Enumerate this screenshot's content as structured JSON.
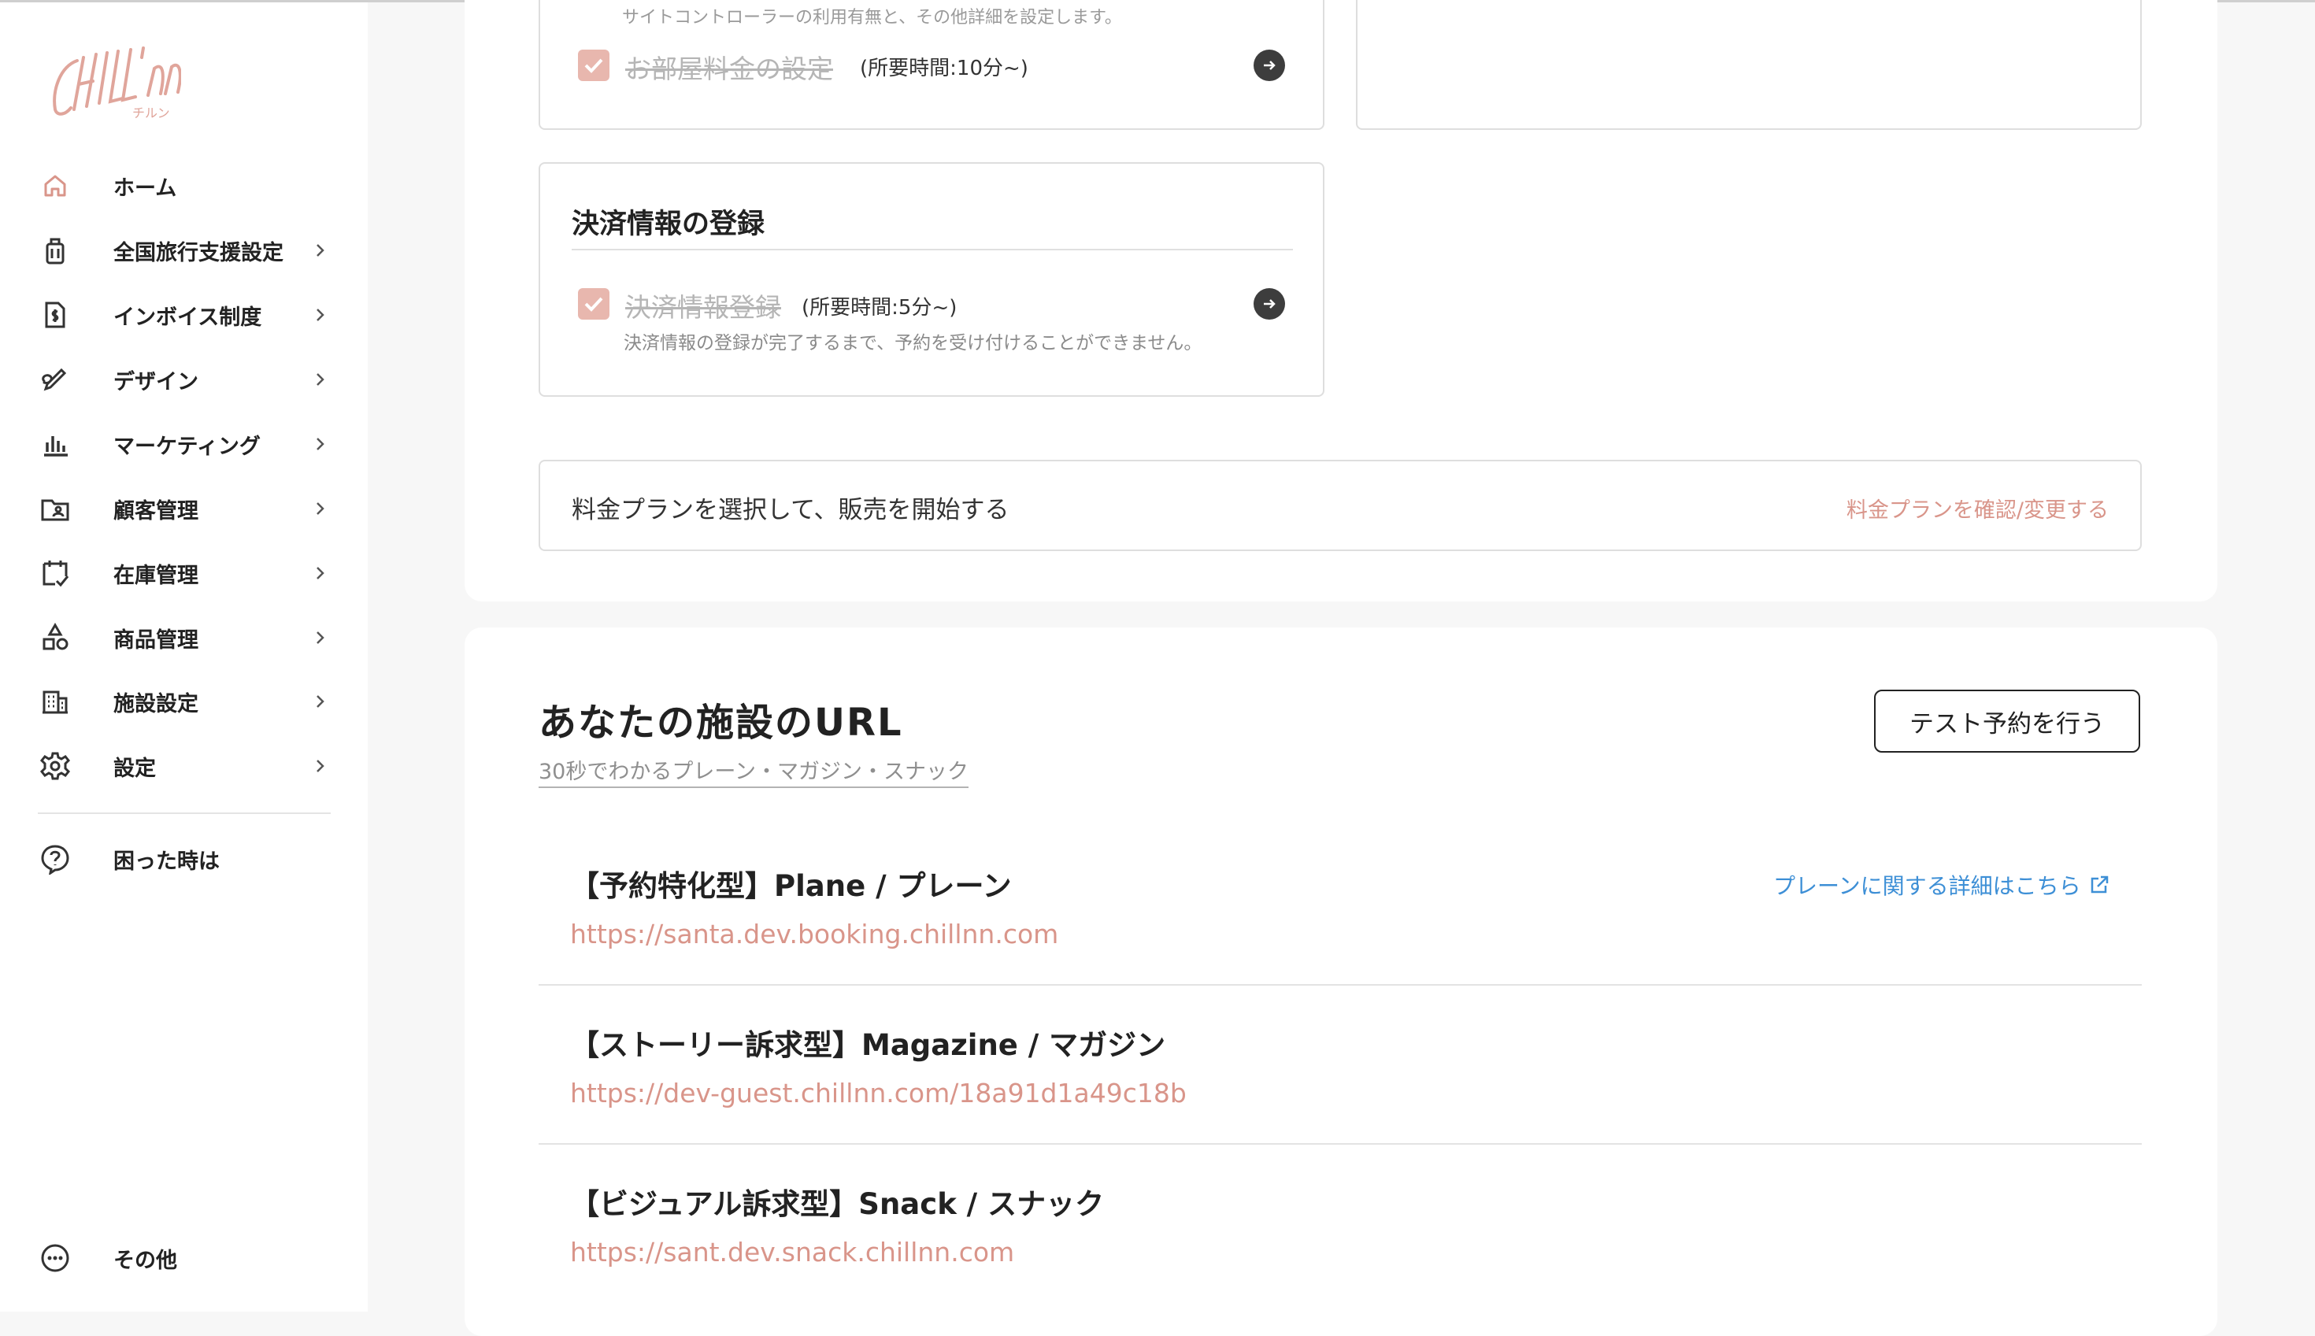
{
  "brand": {
    "logo_text": "CHILL'NN",
    "logo_sub": "チルン",
    "accent_color": "#d9958a",
    "link_color": "#3d8fd6"
  },
  "sidebar": {
    "items": [
      {
        "label": "ホーム",
        "icon": "home-icon",
        "has_chevron": false
      },
      {
        "label": "全国旅行支援設定",
        "icon": "luggage-icon",
        "has_chevron": true
      },
      {
        "label": "インボイス制度",
        "icon": "invoice-icon",
        "has_chevron": true
      },
      {
        "label": "デザイン",
        "icon": "pen-icon",
        "has_chevron": true
      },
      {
        "label": "マーケティング",
        "icon": "bar-chart-icon",
        "has_chevron": true
      },
      {
        "label": "顧客管理",
        "icon": "customer-folder-icon",
        "has_chevron": true
      },
      {
        "label": "在庫管理",
        "icon": "calendar-check-icon",
        "has_chevron": true
      },
      {
        "label": "商品管理",
        "icon": "shapes-icon",
        "has_chevron": true
      },
      {
        "label": "施設設定",
        "icon": "building-icon",
        "has_chevron": true
      },
      {
        "label": "設定",
        "icon": "gear-icon",
        "has_chevron": true
      }
    ],
    "help_label": "困った時は",
    "other_label": "その他"
  },
  "setup": {
    "top_card": {
      "description": "サイトコントローラーの利用有無と、その他詳細を設定します。",
      "task_label": "お部屋料金の設定",
      "task_time": "(所要時間:10分~)"
    },
    "payment_card": {
      "title": "決済情報の登録",
      "task_label": "決済情報登録",
      "task_time": "(所要時間:5分~)",
      "note": "決済情報の登録が完了するまで、予約を受け付けることができません。"
    },
    "plan_bar": {
      "text": "料金プランを選択して、販売を開始する",
      "link": "料金プランを確認/変更する"
    }
  },
  "urls": {
    "title": "あなたの施設のURL",
    "subtitle_link": "30秒でわかるプレーン・マガジン・スナック",
    "test_button": "テスト予約を行う",
    "detail_link": "プレーンに関する詳細はこちら",
    "sites": [
      {
        "name": "【予約特化型】Plane / プレーン",
        "url": "https://santa.dev.booking.chillnn.com"
      },
      {
        "name": "【ストーリー訴求型】Magazine / マガジン",
        "url": "https://dev-guest.chillnn.com/18a91d1a49c18b"
      },
      {
        "name": "【ビジュアル訴求型】Snack / スナック",
        "url": "https://sant.dev.snack.chillnn.com"
      }
    ]
  }
}
